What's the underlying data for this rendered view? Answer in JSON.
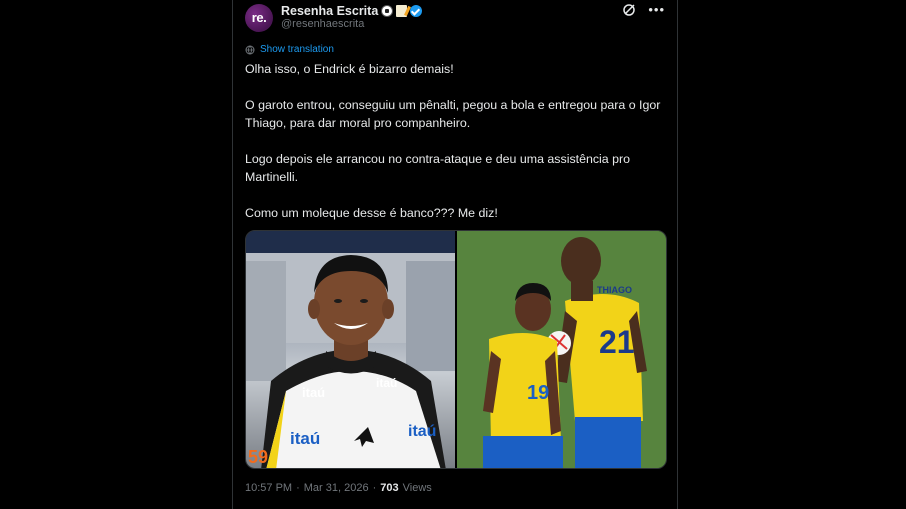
{
  "header": {
    "avatar_text": "re.",
    "display_name": "Resenha Escrita",
    "handle": "@resenhaescrita",
    "name_emojis": [
      "soccer-ball-icon",
      "memo-icon"
    ],
    "verified_color": "#1d9bf0"
  },
  "translate": {
    "label": "Show translation"
  },
  "tweet": {
    "paragraphs": [
      "Olha isso, o Endrick é bizarro demais!",
      "O garoto entrou, conseguiu um pênalti, pegou a bola e entregou para o Igor Thiago, para dar moral pro companheiro.",
      "Logo depois ele arrancou no contra-ataque e deu uma assistência pro Martinelli.",
      "Como um moleque desse é banco??? Me diz!"
    ]
  },
  "media": {
    "left_photo": {
      "shirt_text_1": "itaú",
      "shirt_text_2": "itaú",
      "shirt_text_3": "itaú",
      "shirt_text_4": "itaú",
      "corner_text": "59"
    },
    "right_photo": {
      "name_on_shirt": "THIAGO",
      "number_back": "21",
      "number_front": "19"
    }
  },
  "meta": {
    "time": "10:57 PM",
    "separator": "·",
    "date": "Mar 31, 2026",
    "views_count": "703",
    "views_label": "Views"
  },
  "colors": {
    "background": "#000000",
    "text": "#e7e9ea",
    "muted": "#71767b",
    "link": "#1d9bf0",
    "border": "#2f3336",
    "avatar": "#5b1a66",
    "jersey_yellow": "#f2d318",
    "shorts_blue": "#1b5fc4"
  }
}
